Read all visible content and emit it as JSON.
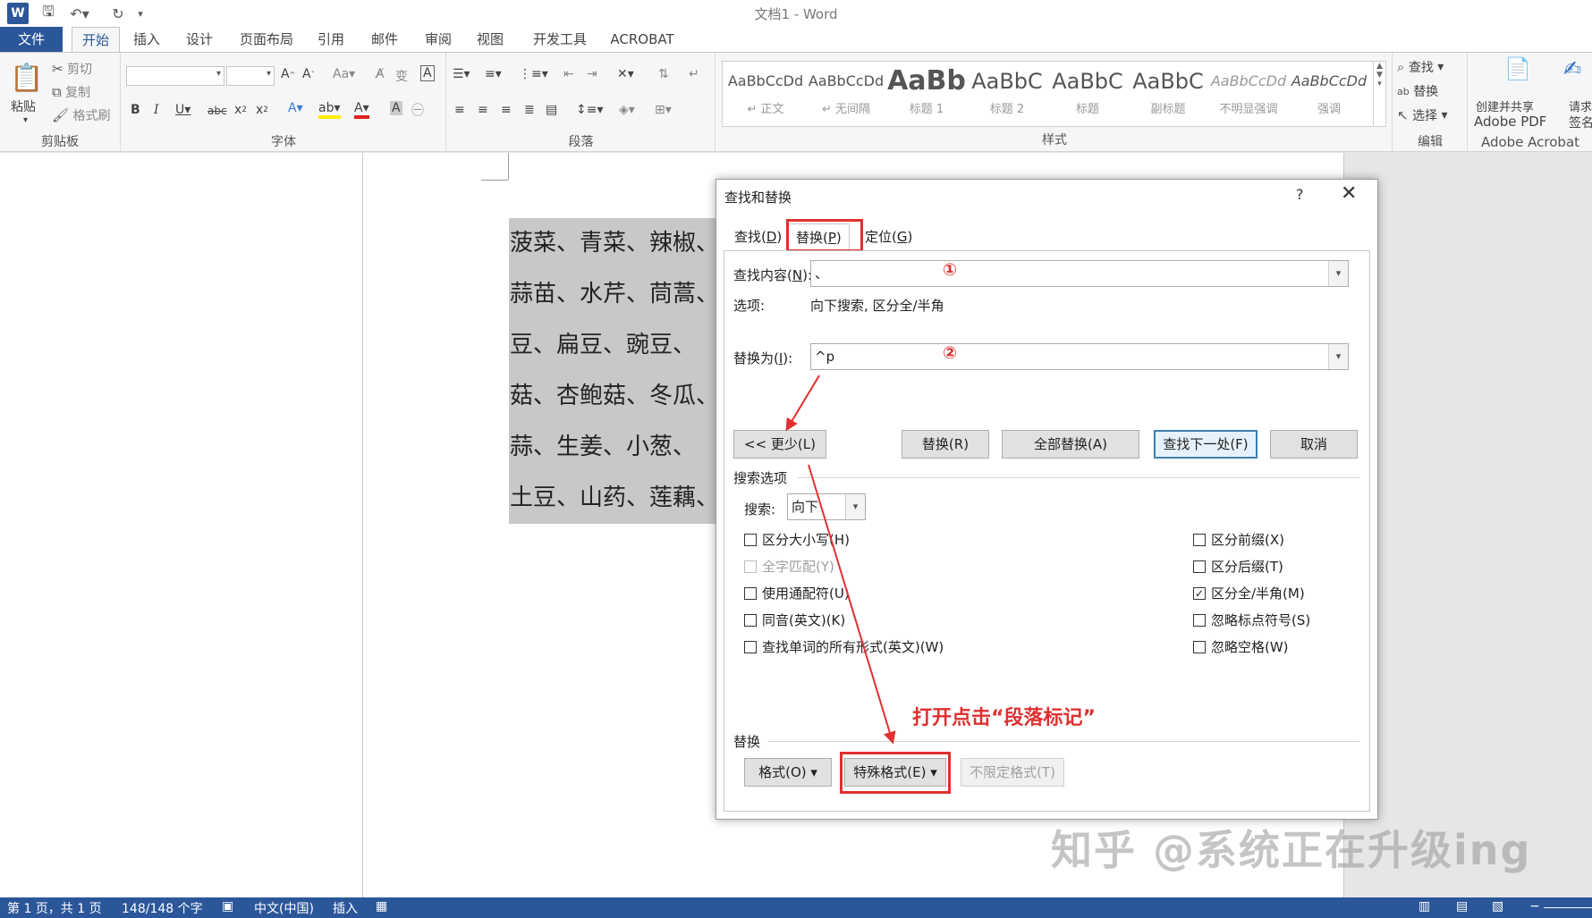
{
  "title_bar": {
    "title": "文档1 - Word"
  },
  "menu_tabs": [
    "文件",
    "开始",
    "插入",
    "设计",
    "页面布局",
    "引用",
    "邮件",
    "审阅",
    "视图",
    "开发工具",
    "ACROBAT"
  ],
  "ribbon": {
    "clipboard": {
      "label": "剪贴板",
      "paste": "粘贴",
      "cut": "剪切",
      "copy": "复制",
      "format_painter": "格式刷"
    },
    "font": {
      "label": "字体"
    },
    "paragraph": {
      "label": "段落"
    },
    "styles": {
      "label": "样式",
      "items": [
        {
          "preview": "AaBbCcDd",
          "name": "↵ 正文"
        },
        {
          "preview": "AaBbCcDd",
          "name": "↵ 无间隔"
        },
        {
          "preview": "AaBb",
          "name": "标题 1"
        },
        {
          "preview": "AaBbC",
          "name": "标题 2"
        },
        {
          "preview": "AaBbC",
          "name": "标题"
        },
        {
          "preview": "AaBbC",
          "name": "副标题"
        },
        {
          "preview": "AaBbCcDd",
          "name": "不明显强调"
        },
        {
          "preview": "AaBbCcDd",
          "name": "强调"
        }
      ]
    },
    "editing": {
      "label": "编辑",
      "find": "查找",
      "replace": "替换",
      "select": "选择"
    },
    "acrobat": {
      "label": "Adobe Acrobat",
      "create_line1": "创建并共享",
      "create_line2": "Adobe PDF",
      "sign_line1": "请求",
      "sign_line2": "签名"
    }
  },
  "document": {
    "lines": [
      "菠菜、青菜、辣椒、",
      "蒜苗、水芹、茼蒿、",
      "豆、扁豆、豌豆、",
      "菇、杏鲍菇、冬瓜、",
      "蒜、生姜、小葱、",
      "土豆、山药、莲藕、"
    ]
  },
  "dialog": {
    "title": "查找和替换",
    "help": "?",
    "close": "✕",
    "tabs": [
      {
        "label": "查找(",
        "key": "D",
        "end": ")"
      },
      {
        "label": "替换(",
        "key": "P",
        "end": ")"
      },
      {
        "label": "定位(",
        "key": "G",
        "end": ")"
      }
    ],
    "find_label": "查找内容(",
    "find_key": "N",
    "find_end": "):",
    "find_value": "、",
    "options_label": "选项:",
    "options_value": "向下搜索, 区分全/半角",
    "replace_label": "替换为(",
    "replace_key": "I",
    "replace_end": "):",
    "replace_value": "^p",
    "buttons": {
      "less": "<< 更少(L)",
      "replace": "替换(R)",
      "replace_all": "全部替换(A)",
      "find_next": "查找下一处(F)",
      "cancel": "取消"
    },
    "search_options_label": "搜索选项",
    "search_label": "搜索:",
    "search_value": "向下",
    "checks_left": [
      {
        "label": "区分大小写(H)",
        "checked": false,
        "enabled": true
      },
      {
        "label": "全字匹配(Y)",
        "checked": false,
        "enabled": false
      },
      {
        "label": "使用通配符(U)",
        "checked": false,
        "enabled": true
      },
      {
        "label": "同音(英文)(K)",
        "checked": false,
        "enabled": true
      },
      {
        "label": "查找单词的所有形式(英文)(W)",
        "checked": false,
        "enabled": true
      }
    ],
    "checks_right": [
      {
        "label": "区分前缀(X)",
        "checked": false,
        "enabled": true
      },
      {
        "label": "区分后缀(T)",
        "checked": false,
        "enabled": true
      },
      {
        "label": "区分全/半角(M)",
        "checked": true,
        "enabled": true
      },
      {
        "label": "忽略标点符号(S)",
        "checked": false,
        "enabled": true
      },
      {
        "label": "忽略空格(W)",
        "checked": false,
        "enabled": true
      }
    ],
    "replace_section_label": "替换",
    "format_button": "格式(O) ▾",
    "special_button": "特殊格式(E) ▾",
    "no_format_button": "不限定格式(T)"
  },
  "annotations": {
    "step1": "①",
    "step2": "②",
    "instruction": "打开点击“段落标记”",
    "color": "#e03030"
  },
  "watermark": "知乎 @系统正在升级ing",
  "status_bar": {
    "page": "第 1 页，共 1 页",
    "words": "148/148 个字",
    "language": "中文(中国)",
    "mode": "插入"
  },
  "colors": {
    "accent": "#2b579a",
    "annotation": "#e03030"
  }
}
